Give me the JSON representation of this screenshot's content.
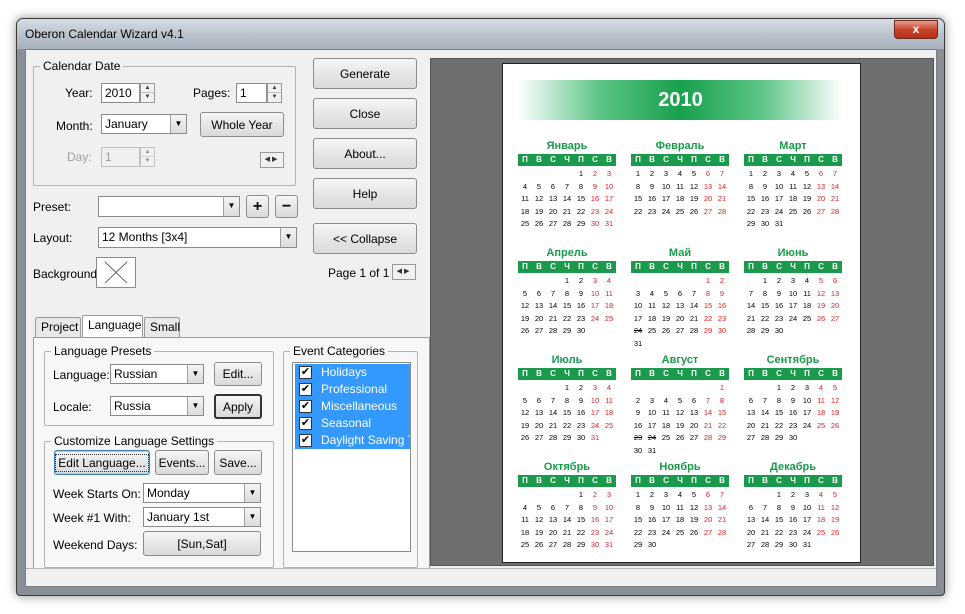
{
  "window": {
    "title": "Oberon Calendar Wizard v4.1",
    "close_glyph": "x"
  },
  "calendar_date": {
    "legend": "Calendar Date",
    "year_label": "Year:",
    "year_value": "2010",
    "pages_label": "Pages:",
    "pages_value": "1",
    "month_label": "Month:",
    "month_value": "January",
    "whole_year_label": "Whole Year",
    "day_label": "Day:",
    "day_value": "1"
  },
  "actions": {
    "generate": "Generate",
    "close": "Close",
    "about": "About...",
    "help": "Help",
    "collapse": "<< Collapse"
  },
  "preset": {
    "label": "Preset:",
    "value": "",
    "add": "+",
    "remove": "−"
  },
  "layout": {
    "label": "Layout:",
    "value": "12 Months [3x4]"
  },
  "background": {
    "label": "Background:"
  },
  "page_info": "Page 1 of 1",
  "tabs": [
    "Project",
    "Language",
    "Small"
  ],
  "language_presets": {
    "legend": "Language Presets",
    "language_label": "Language:",
    "language_value": "Russian",
    "edit": "Edit...",
    "locale_label": "Locale:",
    "locale_value": "Russia",
    "apply": "Apply"
  },
  "customize": {
    "legend": "Customize Language Settings",
    "edit_language": "Edit Language...",
    "events": "Events...",
    "save": "Save...",
    "week_starts_label": "Week Starts On:",
    "week_starts_value": "Monday",
    "week1_label": "Week #1 With:",
    "week1_value": "January 1st",
    "weekend_label": "Weekend Days:",
    "weekend_value": "[Sun,Sat]"
  },
  "event_categories": {
    "legend": "Event Categories",
    "items": [
      "Holidays",
      "Professional",
      "Miscellaneous",
      "Seasonal",
      "Daylight Saving Ti"
    ],
    "check_glyph": "✔"
  },
  "calendar_preview": {
    "year": "2010",
    "dow": [
      "П",
      "В",
      "С",
      "Ч",
      "П",
      "С",
      "В"
    ],
    "months": [
      {
        "name": "Январь",
        "offset": 4,
        "days": 31,
        "holidays": []
      },
      {
        "name": "Февраль",
        "offset": 0,
        "days": 28,
        "holidays": []
      },
      {
        "name": "Март",
        "offset": 0,
        "days": 31,
        "holidays": []
      },
      {
        "name": "Апрель",
        "offset": 3,
        "days": 30,
        "holidays": []
      },
      {
        "name": "Май",
        "offset": 5,
        "days": 31,
        "holidays": [
          24
        ]
      },
      {
        "name": "Июнь",
        "offset": 1,
        "days": 30,
        "holidays": []
      },
      {
        "name": "Июль",
        "offset": 3,
        "days": 31,
        "holidays": []
      },
      {
        "name": "Август",
        "offset": 6,
        "days": 31,
        "holidays": [
          23,
          24
        ]
      },
      {
        "name": "Сентябрь",
        "offset": 2,
        "days": 30,
        "holidays": []
      },
      {
        "name": "Октябрь",
        "offset": 4,
        "days": 31,
        "holidays": []
      },
      {
        "name": "Ноябрь",
        "offset": 0,
        "days": 30,
        "holidays": []
      },
      {
        "name": "Декабрь",
        "offset": 2,
        "days": 31,
        "holidays": []
      }
    ]
  }
}
